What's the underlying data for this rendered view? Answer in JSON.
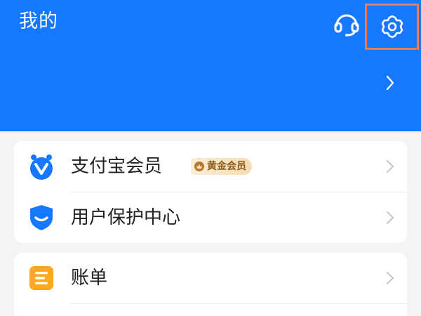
{
  "header": {
    "title": "我的",
    "background_color": "#1677ff",
    "support_icon": "headset-icon",
    "settings_icon": "gear-icon",
    "chevron_icon": "chevron-right-icon",
    "highlight_color": "#f07a4b"
  },
  "card1": {
    "items": [
      {
        "label": "支付宝会员",
        "icon": "member-v-icon",
        "icon_color": "#1677ff",
        "badge": {
          "text": "黄金会员",
          "icon": "crown-icon"
        }
      },
      {
        "label": "用户保护中心",
        "icon": "shield-icon",
        "icon_color": "#1677ff"
      }
    ]
  },
  "card2": {
    "items": [
      {
        "label": "账单",
        "icon": "bill-icon",
        "icon_color": "#ffa81e"
      }
    ]
  }
}
